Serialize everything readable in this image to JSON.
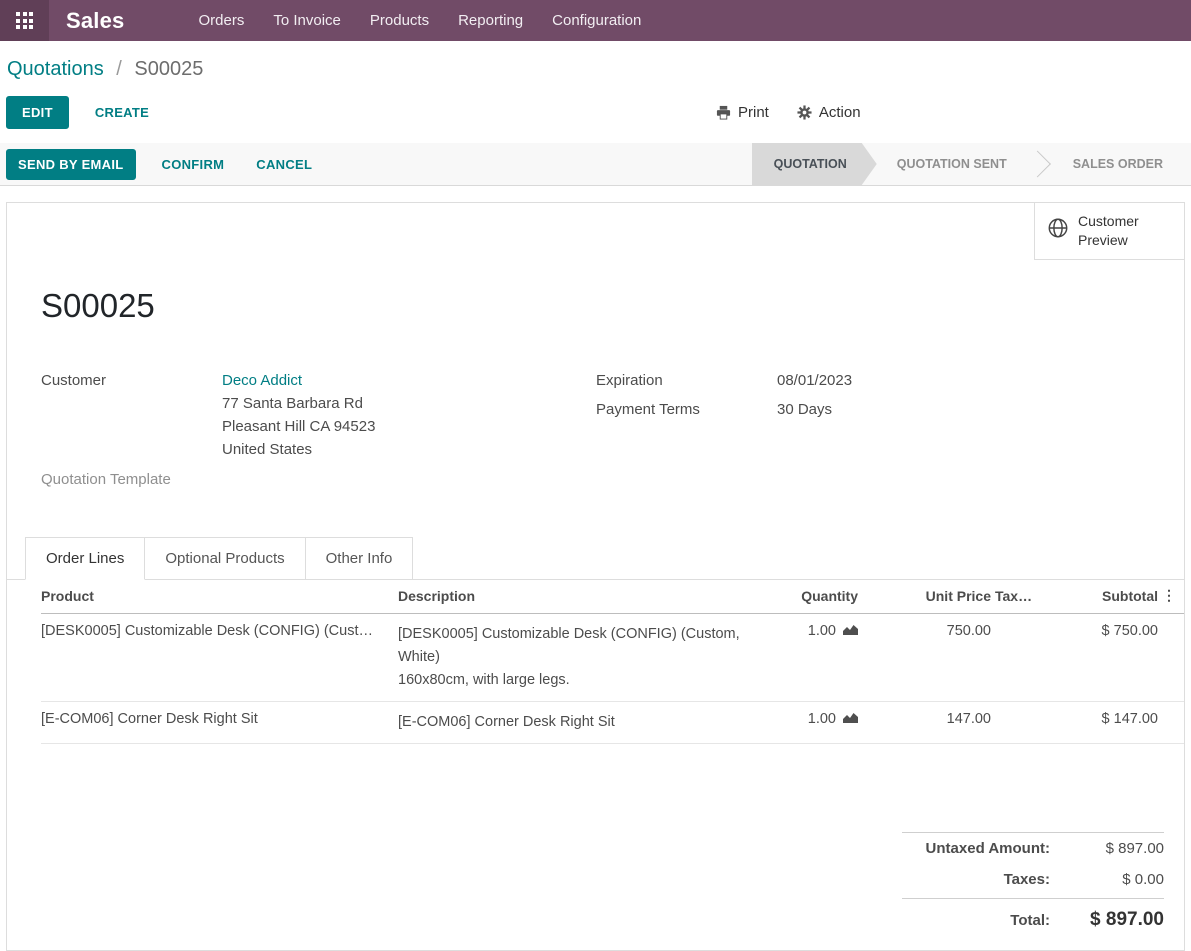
{
  "colors": {
    "topbar": "#714B67",
    "accent": "#017E84",
    "stage_active_bg": "#d9d9d9"
  },
  "icons": {
    "apps": "grid-3x3",
    "print": "printer",
    "action": "gear",
    "customer_preview": "globe",
    "quantity_forecast": "area-chart",
    "optional_columns": "⋮"
  },
  "topbar": {
    "app_name": "Sales",
    "menu": [
      "Orders",
      "To Invoice",
      "Products",
      "Reporting",
      "Configuration"
    ]
  },
  "breadcrumb": {
    "parent": "Quotations",
    "separator": "/",
    "current": "S00025"
  },
  "controls": {
    "edit": "EDIT",
    "create": "CREATE",
    "print": "Print",
    "action": "Action"
  },
  "statusbar": {
    "send_by_email": "SEND BY EMAIL",
    "confirm": "CONFIRM",
    "cancel": "CANCEL",
    "stages": [
      {
        "label": "QUOTATION",
        "active": true
      },
      {
        "label": "QUOTATION SENT",
        "active": false
      },
      {
        "label": "SALES ORDER",
        "active": false
      }
    ]
  },
  "sheet": {
    "customer_preview": "Customer Preview",
    "title": "S00025",
    "fields": {
      "customer_label": "Customer",
      "customer_name": "Deco Addict",
      "customer_address_1": "77 Santa Barbara Rd",
      "customer_address_2": "Pleasant Hill CA 94523",
      "customer_address_3": "United States",
      "quotation_template_label": "Quotation Template",
      "expiration_label": "Expiration",
      "expiration_value": "08/01/2023",
      "payment_terms_label": "Payment Terms",
      "payment_terms_value": "30 Days"
    },
    "tabs": [
      {
        "label": "Order Lines",
        "active": true
      },
      {
        "label": "Optional Products",
        "active": false
      },
      {
        "label": "Other Info",
        "active": false
      }
    ],
    "order_lines": {
      "headers": {
        "product": "Product",
        "description": "Description",
        "quantity": "Quantity",
        "unit_price": "Unit Price",
        "taxes": "Tax…",
        "subtotal": "Subtotal"
      },
      "rows": [
        {
          "product": "[DESK0005] Customizable Desk (CONFIG) (Cust…",
          "description_lines": [
            "[DESK0005] Customizable Desk (CONFIG) (Custom, White)",
            "160x80cm, with large legs."
          ],
          "quantity": "1.00",
          "unit_price": "750.00",
          "taxes": "",
          "subtotal": "$ 750.00"
        },
        {
          "product": "[E-COM06] Corner Desk Right Sit",
          "description_lines": [
            "[E-COM06] Corner Desk Right Sit"
          ],
          "quantity": "1.00",
          "unit_price": "147.00",
          "taxes": "",
          "subtotal": "$ 147.00"
        }
      ]
    },
    "totals": {
      "untaxed_label": "Untaxed Amount:",
      "untaxed_value": "$ 897.00",
      "taxes_label": "Taxes:",
      "taxes_value": "$ 0.00",
      "total_label": "Total:",
      "total_value": "$ 897.00"
    }
  }
}
